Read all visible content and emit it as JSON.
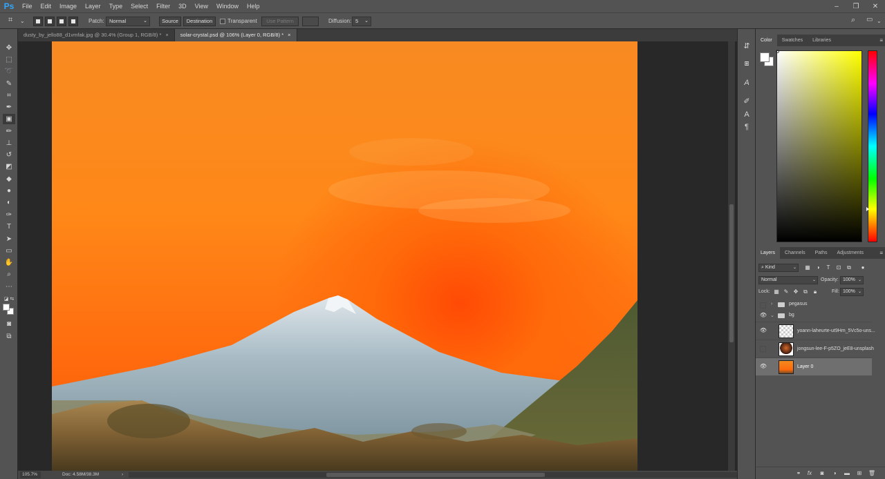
{
  "app": {
    "logo": "Ps"
  },
  "menu": [
    "File",
    "Edit",
    "Image",
    "Layer",
    "Type",
    "Select",
    "Filter",
    "3D",
    "View",
    "Window",
    "Help"
  ],
  "window_controls": {
    "minimize": "–",
    "restore": "❐",
    "close": "✕"
  },
  "options_bar": {
    "patch_label": "Patch:",
    "patch_mode": "Normal",
    "source_label": "Source",
    "destination_label": "Destination",
    "transparent_label": "Transparent",
    "use_pattern_label": "Use Pattern",
    "diffusion_label": "Diffusion:",
    "diffusion_value": "5"
  },
  "doc_tabs": [
    {
      "label": "dusty_by_jello88_d1vmfak.jpg @ 30.4% (Group 1, RGB/8) *",
      "close": "×",
      "active": false
    },
    {
      "label": "solar-crystal.psd @ 106% (Layer 0, RGB/8) *",
      "close": "×",
      "active": true
    }
  ],
  "status": {
    "zoom": "105.7%",
    "doc_size": "Doc: 4.58M/38.3M",
    "arrow": "›"
  },
  "color_panel": {
    "tabs": [
      "Color",
      "Swatches",
      "Libraries"
    ],
    "active_tab": "Color",
    "hue_color": "#ffff00"
  },
  "layers_panel": {
    "tabs": [
      "Layers",
      "Channels",
      "Paths",
      "Adjustments"
    ],
    "active_tab": "Layers",
    "filter_kind": "Kind",
    "blend_mode": "Normal",
    "opacity_label": "Opacity:",
    "opacity_value": "100%",
    "lock_label": "Lock:",
    "fill_label": "Fill:",
    "fill_value": "100%",
    "layers": [
      {
        "name": "pegasus",
        "type": "group",
        "visible": false,
        "expanded": false
      },
      {
        "name": "bg",
        "type": "group",
        "visible": true,
        "expanded": true
      },
      {
        "name": "yoann-laheurte-ut9Hm_5Vc5o-uns...",
        "type": "layer",
        "visible": true
      },
      {
        "name": "jongsun-lee-F-p5ZO_jeE8-unsplash",
        "type": "layer",
        "visible": false
      },
      {
        "name": "Layer 0",
        "type": "layer",
        "visible": true,
        "selected": true
      }
    ]
  },
  "canvas": {
    "sky_top": "#f78a22",
    "sky_bottom": "#f05a08",
    "mountain": "#9fb3bd"
  }
}
